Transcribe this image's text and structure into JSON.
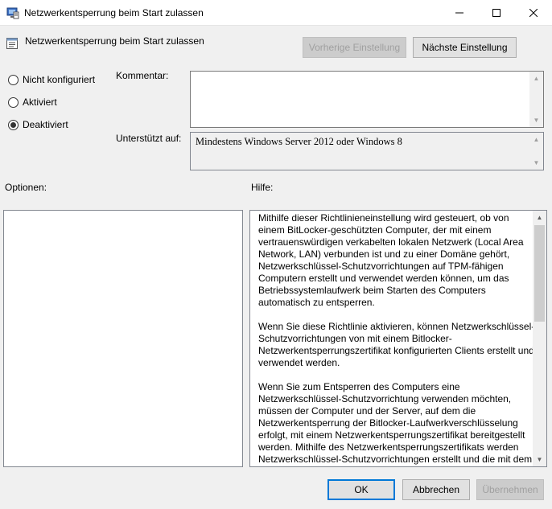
{
  "window": {
    "title": "Netzwerkentsperrung beim Start zulassen",
    "minimize": "—",
    "maximize": "☐",
    "close": "✕"
  },
  "policy": {
    "title": "Netzwerkentsperrung beim Start zulassen",
    "prev_button": "Vorherige Einstellung",
    "next_button": "Nächste Einstellung"
  },
  "state": {
    "options": [
      {
        "label": "Nicht konfiguriert",
        "checked": false
      },
      {
        "label": "Aktiviert",
        "checked": false
      },
      {
        "label": "Deaktiviert",
        "checked": true
      }
    ]
  },
  "comment": {
    "label": "Kommentar:",
    "value": ""
  },
  "supported": {
    "label": "Unterstützt auf:",
    "value": "Mindestens Windows Server 2012 oder Windows 8"
  },
  "options_label": "Optionen:",
  "help_label": "Hilfe:",
  "help_paragraphs": [
    "Mithilfe dieser Richtlinieneinstellung wird gesteuert, ob von einem BitLocker-geschützten Computer, der mit einem vertrauenswürdigen verkabelten lokalen Netzwerk (Local Area Network, LAN) verbunden ist und zu einer Domäne gehört, Netzwerkschlüssel-Schutzvorrichtungen auf TPM-fähigen Computern erstellt und verwendet werden können, um das Betriebssystemlaufwerk beim Starten des Computers automatisch zu entsperren.",
    "Wenn Sie diese Richtlinie aktivieren, können Netzwerkschlüssel-Schutzvorrichtungen von mit einem Bitlocker-Netzwerkentsperrungszertifikat konfigurierten Clients erstellt und verwendet werden.",
    "Wenn Sie zum Entsperren des Computers eine Netzwerkschlüssel-Schutzvorrichtung verwenden möchten, müssen der Computer und der Server, auf dem die Netzwerkentsperrung der Bitlocker-Laufwerkverschlüsselung erfolgt, mit einem Netzwerkentsperrungszertifikat bereitgestellt werden. Mithilfe des Netzwerkentsperrungszertifikats werden Netzwerkschlüssel-Schutzvorrichtungen erstellt und die mit dem"
  ],
  "footer": {
    "ok": "OK",
    "cancel": "Abbrechen",
    "apply": "Übernehmen"
  },
  "colors": {
    "accent": "#0078d7",
    "background": "#f0f0f0"
  },
  "icons": {
    "app": "group-policy-icon",
    "policy": "policy-setting-icon",
    "up": "▲",
    "down": "▼"
  }
}
